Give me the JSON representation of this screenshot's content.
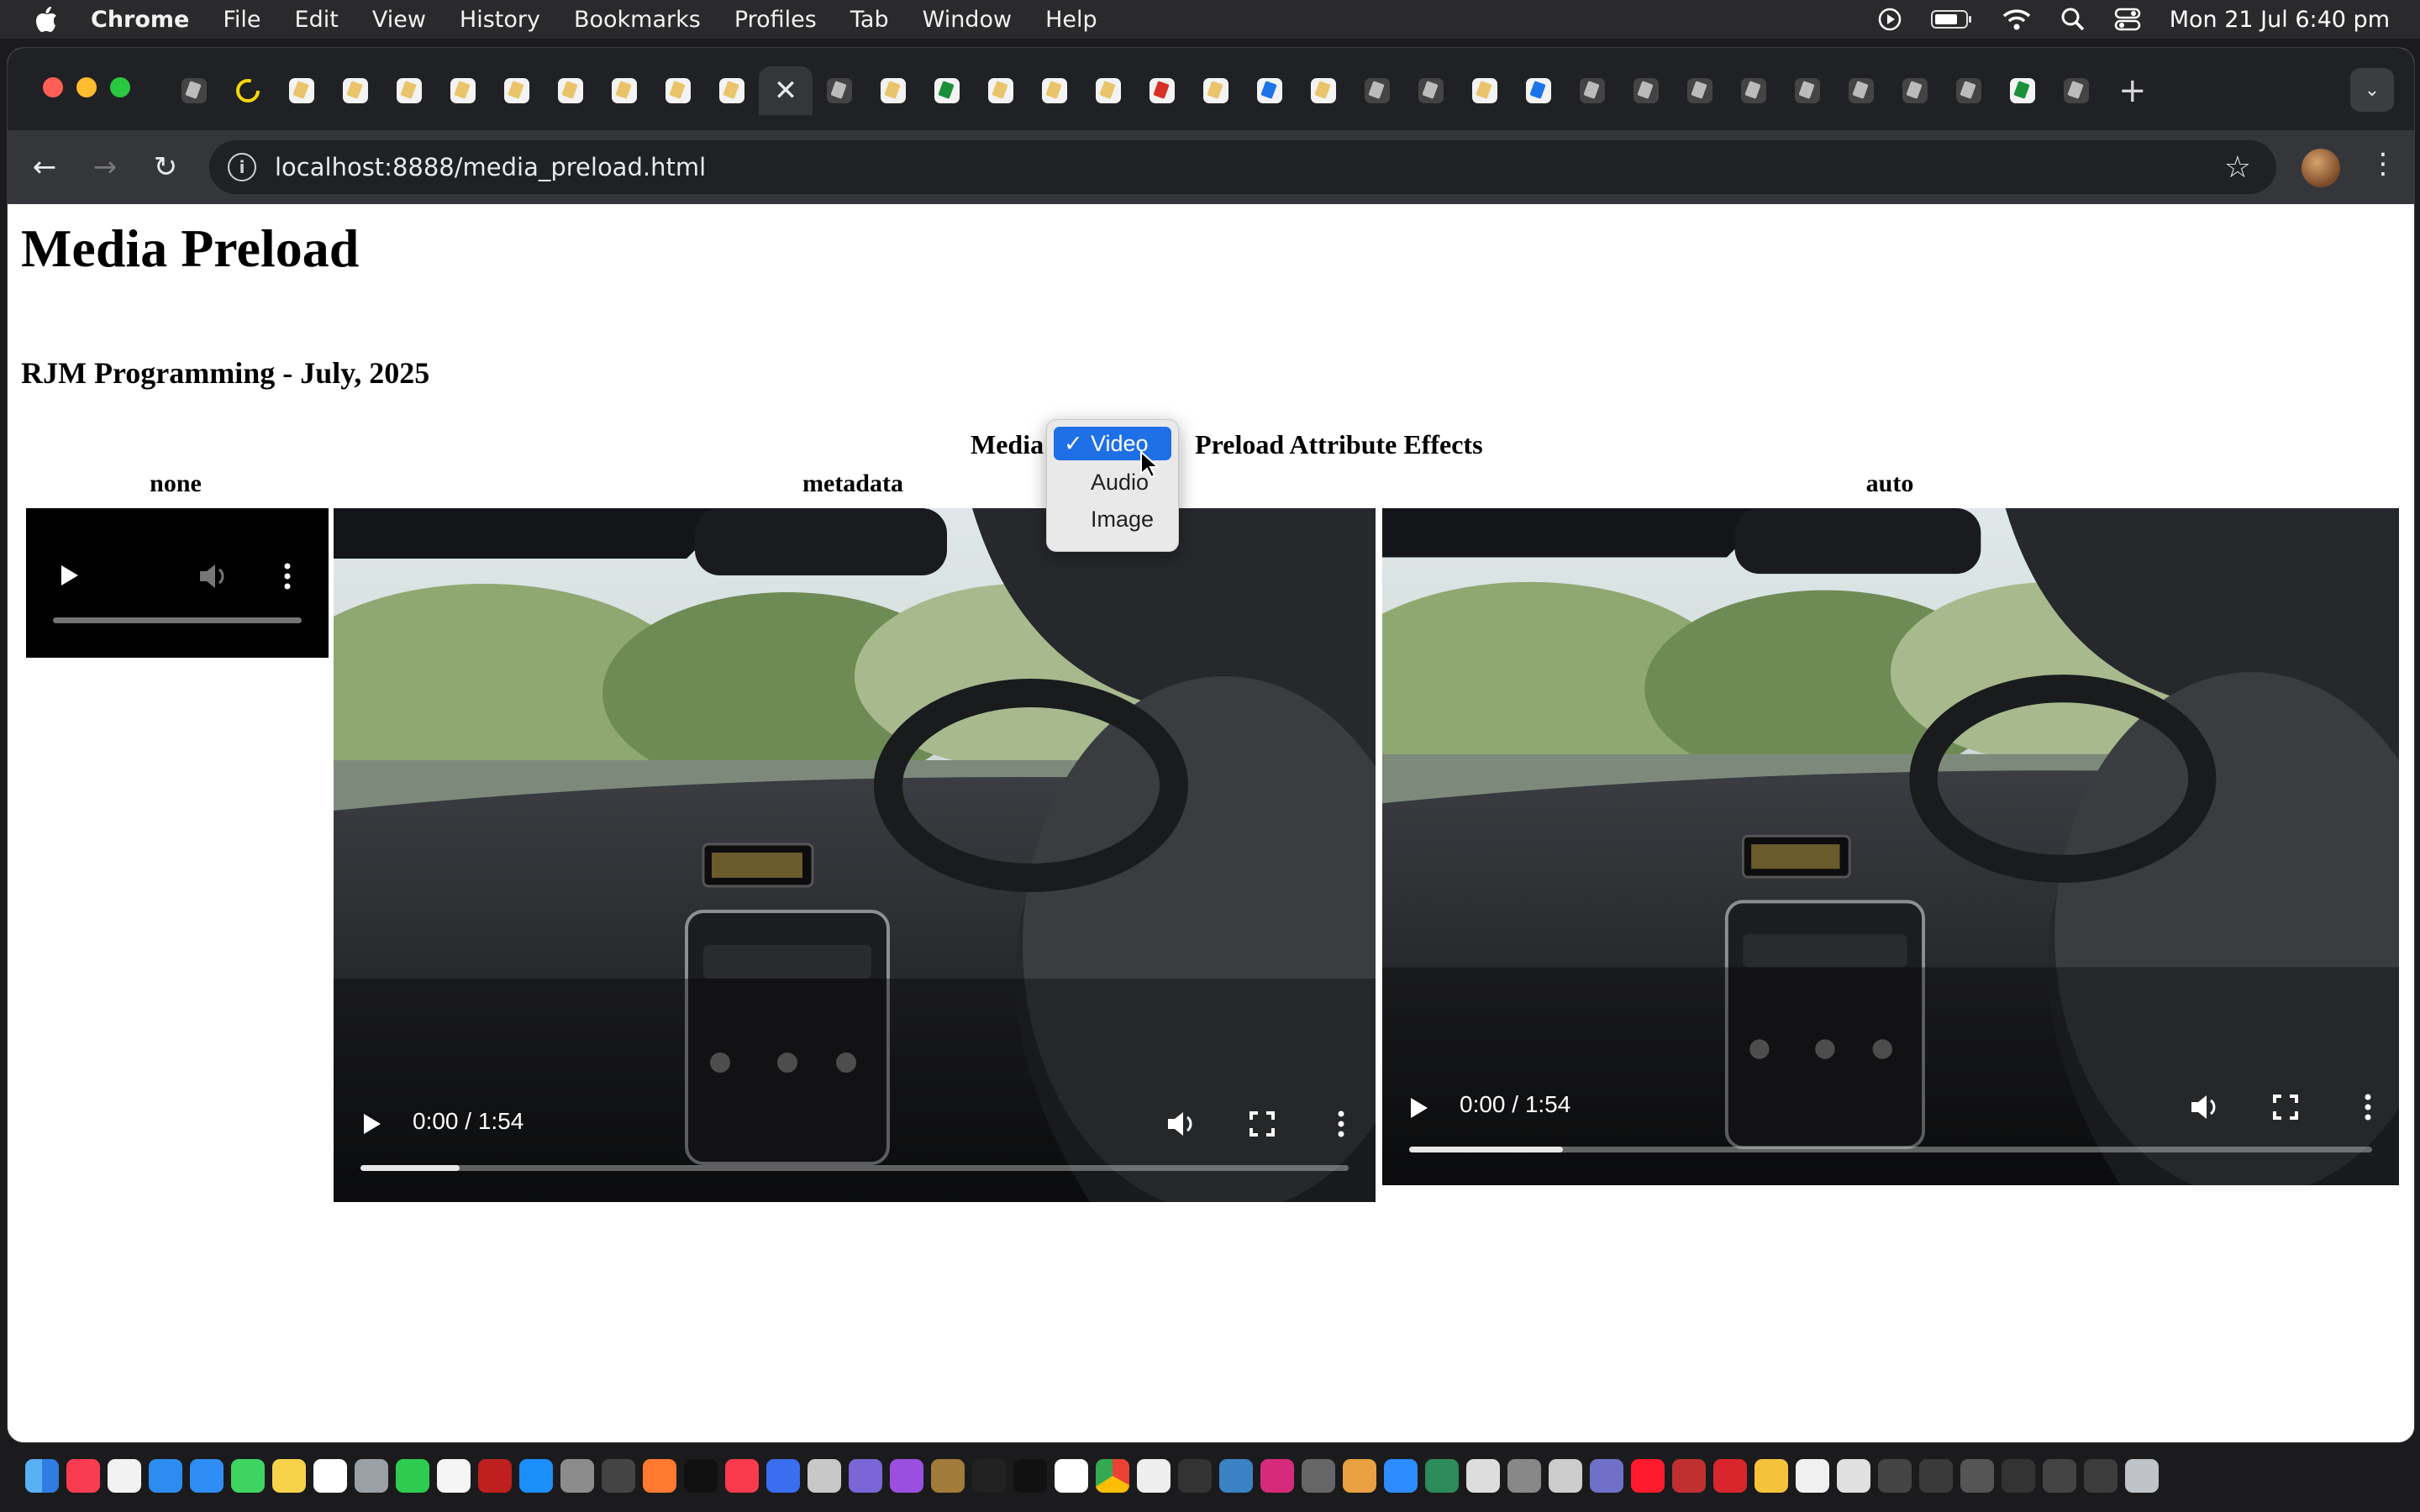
{
  "menubar": {
    "app": "Chrome",
    "items": [
      "File",
      "Edit",
      "View",
      "History",
      "Bookmarks",
      "Profiles",
      "Tab",
      "Window",
      "Help"
    ],
    "datetime": "Mon 21 Jul  6:40 pm"
  },
  "browser": {
    "url": "localhost:8888/media_preload.html"
  },
  "page": {
    "title": "Media Preload",
    "subtitle": "RJM Programming - July, 2025",
    "caption_left": "Media",
    "caption_right": "Preload Attribute Effects",
    "columns": [
      "none",
      "metadata",
      "auto"
    ],
    "media_select": {
      "options": [
        "Video",
        "Audio",
        "Image"
      ],
      "selected": "Video"
    },
    "players": {
      "metadata": {
        "time": "0:00 / 1:54",
        "buffered": 0.1
      },
      "auto": {
        "time": "0:00 / 1:54",
        "buffered": 0.16
      }
    }
  },
  "colors": {
    "select_highlight": "#1f6fe6",
    "video_bg": "#000000"
  }
}
